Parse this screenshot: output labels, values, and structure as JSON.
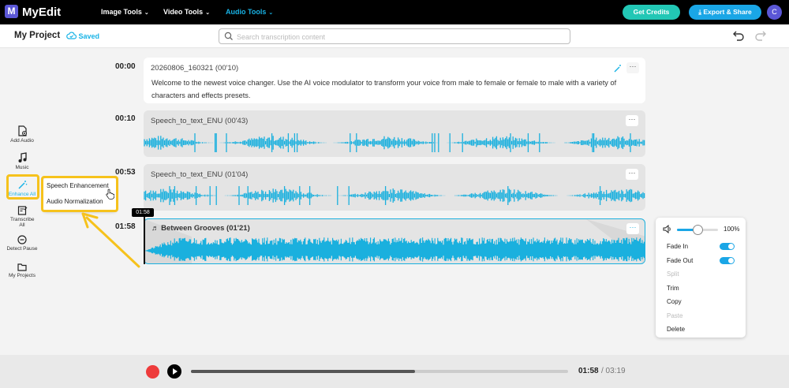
{
  "app": {
    "name": "MyEdit",
    "logo_letter": "M"
  },
  "nav": {
    "items": [
      {
        "label": "Image Tools",
        "active": false
      },
      {
        "label": "Video Tools",
        "active": false
      },
      {
        "label": "Audio Tools",
        "active": true
      }
    ]
  },
  "header_buttons": {
    "credits": "Get Credits",
    "export": "Export & Share",
    "avatar": "C"
  },
  "project": {
    "title": "My Project",
    "status": "Saved"
  },
  "search": {
    "placeholder": "Search transcription content"
  },
  "sidebar": {
    "items": [
      {
        "label": "Add Audio",
        "icon": "add-audio-icon"
      },
      {
        "label": "Music",
        "icon": "music-note-icon"
      },
      {
        "label": "Enhance All",
        "icon": "magic-wand-icon",
        "active": true
      },
      {
        "label": "Transcribe All",
        "icon": "transcribe-icon"
      },
      {
        "label": "Detect Pause",
        "icon": "pause-circle-icon"
      },
      {
        "label": "My Projects",
        "icon": "folder-icon"
      }
    ]
  },
  "enhance_menu": {
    "items": [
      "Speech Enhancement",
      "Audio Normalization"
    ]
  },
  "clips": [
    {
      "timestamp": "00:00",
      "title": "20260806_160321  (00'10)",
      "text": "Welcome to the newest voice changer. Use the AI voice modulator to transform your voice from male to female or female to male with a variety of characters and effects presets."
    },
    {
      "timestamp": "00:10",
      "title": "Speech_to_text_ENU  (00'43)"
    },
    {
      "timestamp": "00:53",
      "title": "Speech_to_text_ENU  (01'04)"
    },
    {
      "timestamp": "01:58",
      "title": "Between Grooves  (01'21)",
      "selected": true
    }
  ],
  "playhead_label": "01:58",
  "context_menu": {
    "volume": "100%",
    "volume_level": 0.5,
    "fade_in": {
      "label": "Fade In",
      "on": true
    },
    "fade_out": {
      "label": "Fade Out",
      "on": true
    },
    "actions": [
      {
        "label": "Split",
        "enabled": false
      },
      {
        "label": "Trim",
        "enabled": true
      },
      {
        "label": "Copy",
        "enabled": true
      },
      {
        "label": "Paste",
        "enabled": false
      },
      {
        "label": "Delete",
        "enabled": true
      }
    ]
  },
  "player": {
    "current": "01:58",
    "total": "/ 03:19",
    "progress": 0.595
  },
  "colors": {
    "accent": "#18b3e6",
    "wave": "#1ab0de",
    "highlight": "#f6c21c",
    "record": "#ee3b3b"
  }
}
